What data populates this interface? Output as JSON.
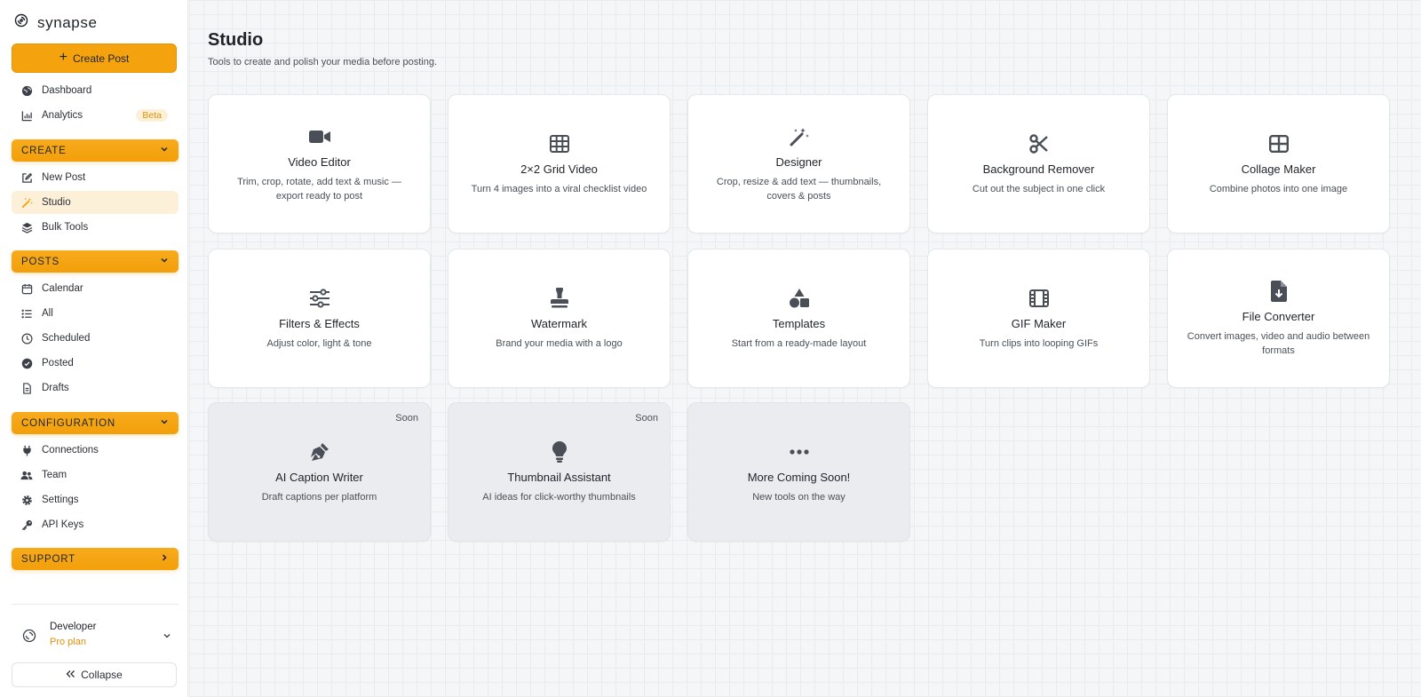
{
  "brand": {
    "name": "synapse"
  },
  "sidebar": {
    "create_button": "Create Post",
    "top_items": [
      {
        "label": "Dashboard",
        "icon": "globe-icon"
      },
      {
        "label": "Analytics",
        "icon": "chart-icon",
        "badge": "Beta"
      }
    ],
    "sections": [
      {
        "title": "CREATE",
        "items": [
          {
            "label": "New Post",
            "icon": "edit-icon"
          },
          {
            "label": "Studio",
            "icon": "magic-wand-icon",
            "active": true
          },
          {
            "label": "Bulk Tools",
            "icon": "layers-icon"
          }
        ]
      },
      {
        "title": "POSTS",
        "items": [
          {
            "label": "Calendar",
            "icon": "calendar-icon"
          },
          {
            "label": "All",
            "icon": "list-icon"
          },
          {
            "label": "Scheduled",
            "icon": "clock-icon"
          },
          {
            "label": "Posted",
            "icon": "check-circle-icon"
          },
          {
            "label": "Drafts",
            "icon": "file-icon"
          }
        ]
      },
      {
        "title": "CONFIGURATION",
        "items": [
          {
            "label": "Connections",
            "icon": "plug-icon"
          },
          {
            "label": "Team",
            "icon": "users-icon"
          },
          {
            "label": "Settings",
            "icon": "gear-icon"
          },
          {
            "label": "API Keys",
            "icon": "key-icon"
          }
        ]
      },
      {
        "title": "SUPPORT",
        "items": []
      }
    ],
    "user": {
      "name": "Developer",
      "plan": "Pro plan"
    },
    "collapse_label": "Collapse"
  },
  "main": {
    "title": "Studio",
    "subtitle": "Tools to create and polish your media before posting.",
    "tools": [
      {
        "title": "Video Editor",
        "desc": "Trim, crop, rotate, add text & music — export ready to post",
        "icon": "video-camera-icon"
      },
      {
        "title": "2×2 Grid Video",
        "desc": "Turn 4 images into a viral checklist video",
        "icon": "grid-icon"
      },
      {
        "title": "Designer",
        "desc": "Crop, resize & add text — thumbnails, covers & posts",
        "icon": "magic-wand-icon"
      },
      {
        "title": "Background Remover",
        "desc": "Cut out the subject in one click",
        "icon": "scissors-icon"
      },
      {
        "title": "Collage Maker",
        "desc": "Combine photos into one image",
        "icon": "collage-icon"
      },
      {
        "title": "Filters & Effects",
        "desc": "Adjust color, light & tone",
        "icon": "sliders-icon"
      },
      {
        "title": "Watermark",
        "desc": "Brand your media with a logo",
        "icon": "stamp-icon"
      },
      {
        "title": "Templates",
        "desc": "Start from a ready-made layout",
        "icon": "shapes-icon"
      },
      {
        "title": "GIF Maker",
        "desc": "Turn clips into looping GIFs",
        "icon": "film-icon"
      },
      {
        "title": "File Converter",
        "desc": "Convert images, video and audio between formats",
        "icon": "file-download-icon"
      },
      {
        "title": "AI Caption Writer",
        "desc": "Draft captions per platform",
        "icon": "pen-nib-icon",
        "badge": "Soon",
        "disabled": true
      },
      {
        "title": "Thumbnail Assistant",
        "desc": "AI ideas for click-worthy thumbnails",
        "icon": "lightbulb-icon",
        "badge": "Soon",
        "disabled": true
      },
      {
        "title": "More Coming Soon!",
        "desc": "New tools on the way",
        "icon": "ellipsis-icon",
        "disabled": true
      }
    ]
  },
  "colors": {
    "accent": "#f5a20f",
    "accent_light": "#fdf0d9",
    "icon": "#4a4f57"
  }
}
